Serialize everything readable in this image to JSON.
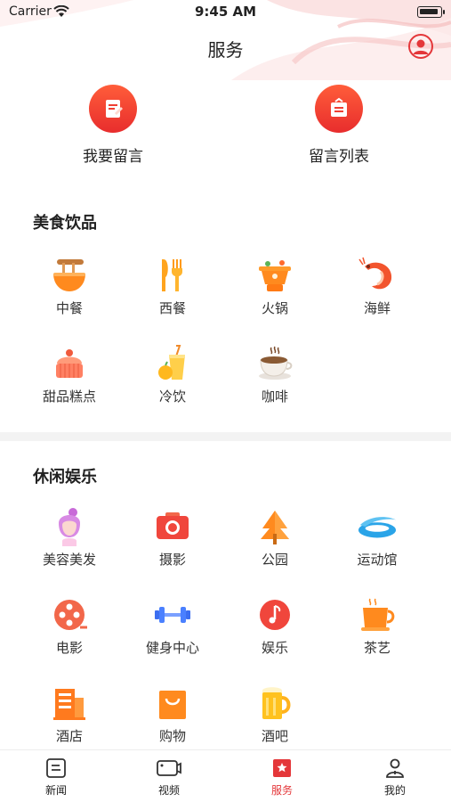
{
  "status_bar": {
    "carrier": "Carrier",
    "time": "9:45 AM"
  },
  "nav": {
    "title": "服务"
  },
  "quick_actions": [
    {
      "label": "我要留言",
      "icon": "note-edit-icon"
    },
    {
      "label": "留言列表",
      "icon": "message-list-icon"
    }
  ],
  "sections": [
    {
      "title": "美食饮品",
      "items": [
        {
          "label": "中餐",
          "icon": "noodle-bowl-icon"
        },
        {
          "label": "西餐",
          "icon": "fork-knife-icon"
        },
        {
          "label": "火锅",
          "icon": "hotpot-icon"
        },
        {
          "label": "海鲜",
          "icon": "shrimp-icon"
        },
        {
          "label": "甜品糕点",
          "icon": "cake-icon"
        },
        {
          "label": "冷饮",
          "icon": "cold-drink-icon"
        },
        {
          "label": "咖啡",
          "icon": "coffee-cup-icon"
        }
      ]
    },
    {
      "title": "休闲娱乐",
      "items": [
        {
          "label": "美容美发",
          "icon": "hair-salon-icon"
        },
        {
          "label": "摄影",
          "icon": "camera-icon"
        },
        {
          "label": "公园",
          "icon": "tree-icon"
        },
        {
          "label": "运动馆",
          "icon": "stadium-icon"
        },
        {
          "label": "电影",
          "icon": "film-reel-icon"
        },
        {
          "label": "健身中心",
          "icon": "dumbbell-icon"
        },
        {
          "label": "娱乐",
          "icon": "music-note-icon"
        },
        {
          "label": "茶艺",
          "icon": "tea-cup-icon"
        },
        {
          "label": "酒店",
          "icon": "hotel-icon"
        },
        {
          "label": "购物",
          "icon": "shopping-bag-icon"
        },
        {
          "label": "酒吧",
          "icon": "beer-mug-icon"
        }
      ]
    }
  ],
  "tabbar": [
    {
      "label": "新闻",
      "icon": "news-icon",
      "active": false
    },
    {
      "label": "视频",
      "icon": "video-icon",
      "active": false
    },
    {
      "label": "服务",
      "icon": "service-icon",
      "active": true
    },
    {
      "label": "我的",
      "icon": "user-icon",
      "active": false
    }
  ],
  "colors": {
    "accent": "#e4373a",
    "icon_orange": "#ff8a1e",
    "icon_red": "#f0463c"
  }
}
